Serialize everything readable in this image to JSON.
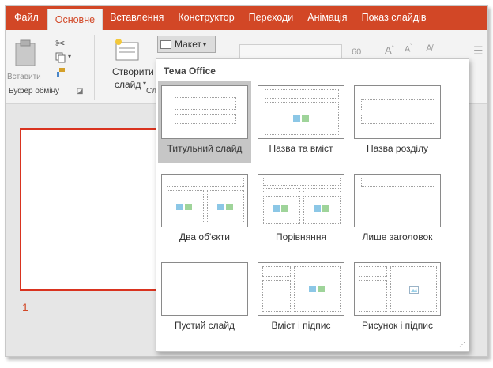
{
  "tabs": [
    "Файл",
    "Основне",
    "Вставлення",
    "Конструктор",
    "Переходи",
    "Анімація",
    "Показ слайдів"
  ],
  "ribbon": {
    "paste_label": "Вставити",
    "clipboard_group": "Буфер обміну",
    "new_slide_label_1": "Створити",
    "new_slide_label_2": "слайд",
    "slides_group_fragment": "Сл",
    "layout_button": "Макет",
    "font_size": "60"
  },
  "dropdown": {
    "title": "Тема Office",
    "layouts": [
      "Титульний слайд",
      "Назва та вміст",
      "Назва розділу",
      "Два об'єкти",
      "Порівняння",
      "Лише заголовок",
      "Пустий слайд",
      "Вміст і підпис",
      "Рисунок і підпис"
    ]
  },
  "slide_panel": {
    "slide_number": "1"
  },
  "colors": {
    "accent": "#d24726",
    "ribbon_bg": "#f3f3f3",
    "selection": "#c6c6c6"
  }
}
